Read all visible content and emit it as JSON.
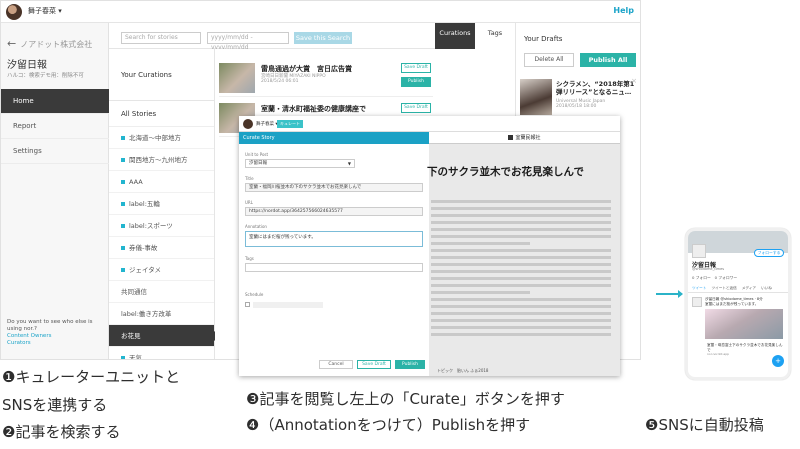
{
  "app": {
    "user_name": "舞子春菜 ▾",
    "help": "Help",
    "search_placeholder": "Search for stories",
    "date_placeholder": "yyyy/mm/dd - yyyy/mm/dd",
    "save_search": "Save this Search"
  },
  "sidebar": {
    "back": "ノアドット株式会社",
    "org_name": "汐留日報",
    "org_sub": "ハルコ：検索デモ用：削除不可",
    "nav": [
      "Home",
      "Report",
      "Settings"
    ],
    "footer_q": "Do you want to see who else is using nor.?",
    "footer_link1": "Content Owners",
    "footer_link2": "Curators"
  },
  "stories": {
    "header": "Your Curations",
    "all": "All Stories",
    "items": [
      {
        "label": "北海道〜中部地方",
        "dot": true
      },
      {
        "label": "関西地方〜九州地方",
        "dot": true
      },
      {
        "label": "AAA",
        "dot": true
      },
      {
        "label": "label:五輪",
        "dot": true
      },
      {
        "label": "label:スポーツ",
        "dot": true
      },
      {
        "label": "券儀-事故",
        "dot": true
      },
      {
        "label": "ジェイタメ",
        "dot": true
      },
      {
        "label": "共同通信",
        "dot": false
      },
      {
        "label": "label:働き方改革",
        "dot": false
      },
      {
        "label": "お花見",
        "dot": false,
        "active": true
      },
      {
        "label": "天気",
        "dot": true
      }
    ]
  },
  "feed": {
    "cards": [
      {
        "title": "雷鳥通過が大賞　宮日広告賞",
        "meta1": "宮崎日日新聞 MIYAZAKI NIPPO",
        "meta2": "2018/5/24 06:01",
        "save": "Save Draft",
        "publish": "Publish"
      },
      {
        "title": "室蘭・清水町福祉委の健康講座で",
        "meta1": "",
        "meta2": "",
        "save": "Save Draft",
        "publish": ""
      }
    ]
  },
  "tabs": {
    "curations": "Curations",
    "tags": "Tags"
  },
  "drafts": {
    "title": "Your Drafts",
    "delete_all": "Delete All",
    "publish_all": "Publish All",
    "item_title": "シクラメン、“2018年第1弾リリース”となるニュ…",
    "item_meta1": "Universal Music Japan",
    "item_meta2": "2018/05/18 18:00",
    "close": "×"
  },
  "overlay": {
    "user": "舞子春菜 ▾",
    "btn": "キュレート",
    "modal_title": "Curate Story",
    "unit_label": "Unit to Post",
    "unit_value": "汐留日報",
    "title_label": "Title",
    "title_value": "室蘭・福岡川桜並木の下のサクラ並木でお花見楽しんで",
    "url_label": "URL",
    "url_value": "https://nordot.app/364257566024635577",
    "annotation_label": "Annotation",
    "annotation_value": "室蘭にはまだ桜が残っています。",
    "tags_label": "Tags",
    "schedule_label": "Schedule",
    "cancel": "Cancel",
    "save_draft": "Save Draft",
    "publish": "Publish",
    "paper_name": "室蘭民報社",
    "article_title": "下のサクラ並木でお花見楽しんで",
    "article_link": "トピック　胎いん ふぁ2018"
  },
  "phone": {
    "follow": "フォローする",
    "name": "汐留日報",
    "handle": "@shiodome_times",
    "stats": "0 フォロー　0 フォロワー",
    "tab1": "ツイート",
    "tab2": "ツイートと返信",
    "tab3": "メディア",
    "tab4": "いいね",
    "tweet_name": "汐留日報 @shiodome_times · 8分",
    "tweet_text": "室蘭にはまだ桜が残っています。",
    "tweet_caption": "室蘭・母恋富士下のサクラ並木でお花見楽しんで",
    "tweet_source": "nor.nordot.app"
  },
  "captions": {
    "step1a": "❶キュレーターユニットと",
    "step1b": "SNSを連携する",
    "step2": "❷記事を検索する",
    "step3": "❸記事を閲覧し左上の「Curate」ボタンを押す",
    "step4": "❹（Annotationをつけて）Publishを押す",
    "step5": "❺SNSに自動投稿"
  },
  "colors": {
    "accent": "#2bb3a7",
    "header_blue": "#1ba1c5",
    "twitter": "#1da1f2",
    "dark_nav": "#3a3a3a"
  }
}
